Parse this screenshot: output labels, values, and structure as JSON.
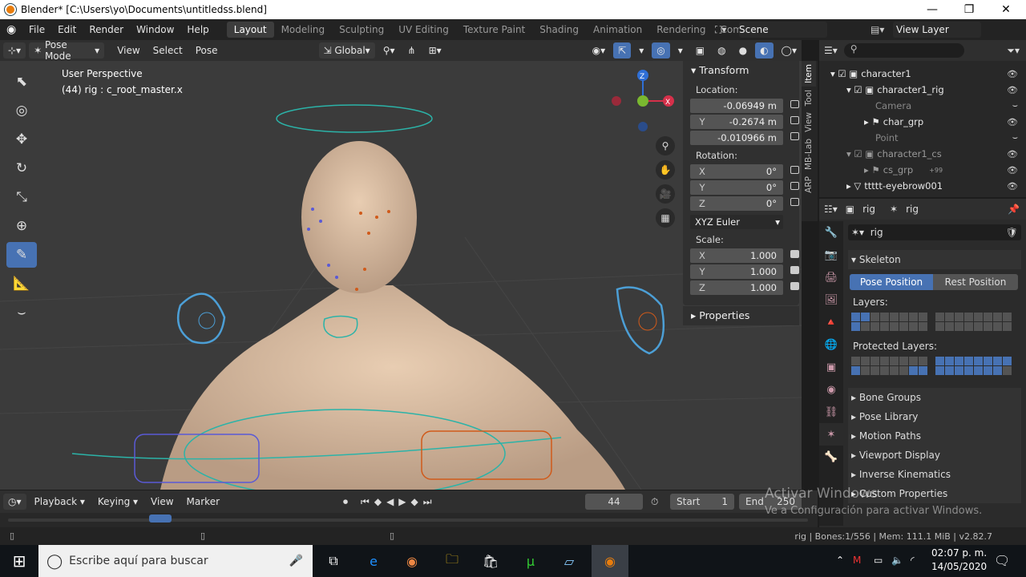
{
  "window": {
    "title": "Blender* [C:\\Users\\yo\\Documents\\untitledss.blend]",
    "min": "—",
    "max": "❐",
    "close": "✕"
  },
  "menu": [
    "File",
    "Edit",
    "Render",
    "Window",
    "Help"
  ],
  "workspaces": [
    "Layout",
    "Modeling",
    "Sculpting",
    "UV Editing",
    "Texture Paint",
    "Shading",
    "Animation",
    "Rendering",
    "Compositing"
  ],
  "scene": {
    "label": "Scene",
    "view_layer": "View Layer"
  },
  "header": {
    "mode": "Pose Mode",
    "view": "View",
    "select": "Select",
    "pose": "Pose",
    "orientation": "Global"
  },
  "viewport": {
    "perspective": "User Perspective",
    "object_info": "(44) rig : c_root_master.x",
    "gizmo_z": "Z",
    "gizmo_x": "X"
  },
  "npanel": {
    "transform": "Transform",
    "location_label": "Location:",
    "location": [
      {
        "axis": "",
        "value": "-0.06949 m"
      },
      {
        "axis": "Y",
        "value": "-0.2674 m"
      },
      {
        "axis": "",
        "value": "-0.010966 m"
      }
    ],
    "rotation_label": "Rotation:",
    "rotation": [
      {
        "axis": "X",
        "value": "0°"
      },
      {
        "axis": "Y",
        "value": "0°"
      },
      {
        "axis": "Z",
        "value": "0°"
      }
    ],
    "rotation_mode": "XYZ Euler",
    "scale_label": "Scale:",
    "scale": [
      {
        "axis": "X",
        "value": "1.000"
      },
      {
        "axis": "Y",
        "value": "1.000"
      },
      {
        "axis": "Z",
        "value": "1.000"
      }
    ],
    "properties": "Properties"
  },
  "vtabs": [
    "Item",
    "Tool",
    "View",
    "MB-Lab",
    "ARP"
  ],
  "outliner": {
    "rows": [
      {
        "name": "character1",
        "indent": 1,
        "visible": true
      },
      {
        "name": "character1_rig",
        "indent": 2,
        "visible": true
      },
      {
        "name": "Camera",
        "indent": 3,
        "visible": false
      },
      {
        "name": "char_grp",
        "indent": 3,
        "visible": true
      },
      {
        "name": "Point",
        "indent": 3,
        "visible": false
      },
      {
        "name": "character1_cs",
        "indent": 2,
        "visible": true
      },
      {
        "name": "cs_grp",
        "indent": 3,
        "visible": true
      },
      {
        "name": "ttttt-eyebrow001",
        "indent": 1,
        "visible": true
      }
    ],
    "badge_count": "+99"
  },
  "props": {
    "breadcrumb_a": "rig",
    "breadcrumb_b": "rig",
    "datablock": "rig",
    "skeleton": "Skeleton",
    "pose_position": "Pose Position",
    "rest_position": "Rest Position",
    "layers": "Layers:",
    "protected_layers": "Protected Layers:",
    "panels": [
      "Bone Groups",
      "Pose Library",
      "Motion Paths",
      "Viewport Display",
      "Inverse Kinematics",
      "Custom Properties"
    ]
  },
  "timeline": {
    "playback": "Playback",
    "keying": "Keying",
    "view": "View",
    "marker": "Marker",
    "frame": "44",
    "start_label": "Start",
    "start": "1",
    "end_label": "End",
    "end": "250"
  },
  "status": {
    "text": "rig | Bones:1/556 | Mem: 111.1 MiB | v2.82.7"
  },
  "watermark": {
    "line1": "Activar Windows",
    "line2": "Ve a Configuración para activar Windows."
  },
  "taskbar": {
    "search": "Escribe aquí para buscar",
    "time": "02:07 p. m.",
    "date": "14/05/2020"
  }
}
